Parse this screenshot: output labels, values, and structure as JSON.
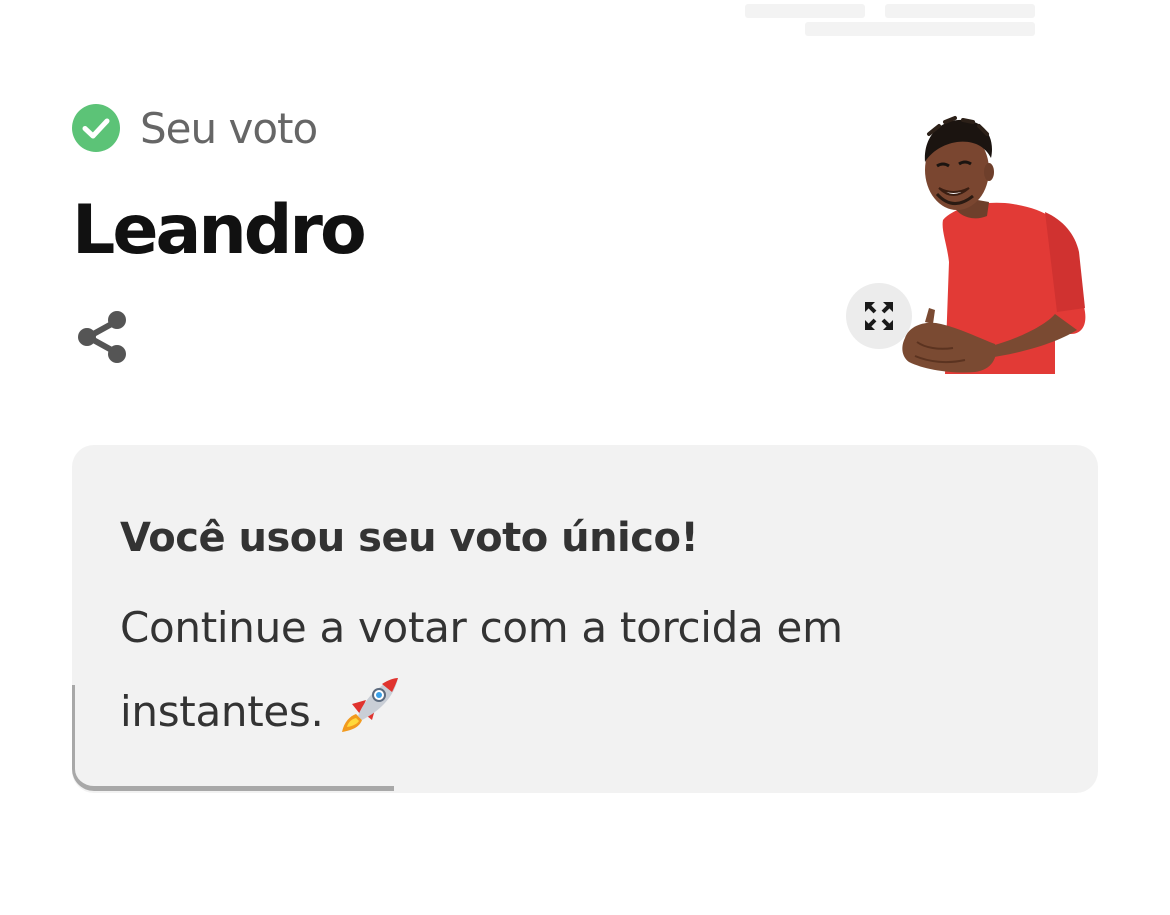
{
  "vote_status": {
    "icon": "check-circle-icon",
    "label": "Seu voto",
    "icon_color": "#5cc377"
  },
  "candidate": {
    "name": "Leandro",
    "photo": "person-red-shirt-smiling",
    "shirt_color": "#e23a36"
  },
  "actions": {
    "share_icon": "share-icon",
    "expand_icon": "expand-icon"
  },
  "info_card": {
    "title": "Você usou seu voto único!",
    "body": "Continue a votar com a torcida em instantes.",
    "emoji_icon": "rocket-icon",
    "background": "#f2f2f2"
  }
}
